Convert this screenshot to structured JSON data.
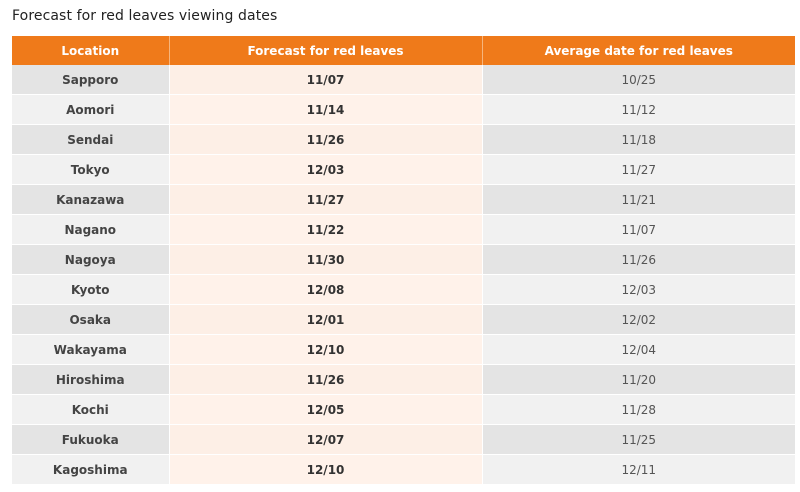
{
  "title": "Forecast for red leaves viewing dates",
  "accent_color": "#ef7a1a",
  "table": {
    "headers": [
      "Location",
      "Forecast for red leaves",
      "Average date for red leaves"
    ],
    "rows": [
      {
        "location": "Sapporo",
        "forecast": "11/07",
        "average": "10/25"
      },
      {
        "location": "Aomori",
        "forecast": "11/14",
        "average": "11/12"
      },
      {
        "location": "Sendai",
        "forecast": "11/26",
        "average": "11/18"
      },
      {
        "location": "Tokyo",
        "forecast": "12/03",
        "average": "11/27"
      },
      {
        "location": "Kanazawa",
        "forecast": "11/27",
        "average": "11/21"
      },
      {
        "location": "Nagano",
        "forecast": "11/22",
        "average": "11/07"
      },
      {
        "location": "Nagoya",
        "forecast": "11/30",
        "average": "11/26"
      },
      {
        "location": "Kyoto",
        "forecast": "12/08",
        "average": "12/03"
      },
      {
        "location": "Osaka",
        "forecast": "12/01",
        "average": "12/02"
      },
      {
        "location": "Wakayama",
        "forecast": "12/10",
        "average": "12/04"
      },
      {
        "location": "Hiroshima",
        "forecast": "11/26",
        "average": "11/20"
      },
      {
        "location": "Kochi",
        "forecast": "12/05",
        "average": "11/28"
      },
      {
        "location": "Fukuoka",
        "forecast": "12/07",
        "average": "11/25"
      },
      {
        "location": "Kagoshima",
        "forecast": "12/10",
        "average": "12/11"
      }
    ]
  }
}
